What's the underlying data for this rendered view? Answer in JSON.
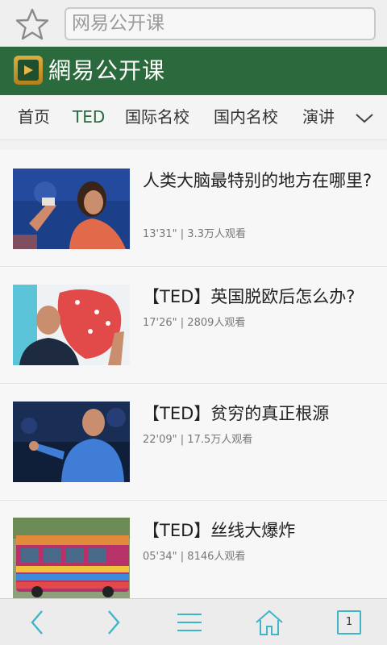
{
  "address_bar": {
    "text": "网易公开课"
  },
  "header": {
    "brand": "網易公开课"
  },
  "tabs": [
    {
      "label": "首页"
    },
    {
      "label": "TED"
    },
    {
      "label": "国际名校"
    },
    {
      "label": "国内名校"
    },
    {
      "label": "演讲"
    }
  ],
  "active_tab": "TED",
  "videos": [
    {
      "title": "人类大脑最特别的地方在哪里?",
      "duration": "13'31\"",
      "views": "3.3万人观看",
      "thumb_icon": "speaker-photo"
    },
    {
      "title": "【TED】英国脱欧后怎么办?",
      "duration": "17'26\"",
      "views": "2809人观看",
      "thumb_icon": "speaker-photo"
    },
    {
      "title": "【TED】贫穷的真正根源",
      "duration": "22'09\"",
      "views": "17.5万人观看",
      "thumb_icon": "speaker-photo"
    },
    {
      "title": "【TED】丝线大爆炸",
      "duration": "05'34\"",
      "views": "8146人观看",
      "thumb_icon": "bus-photo"
    }
  ],
  "bottom_bar": {
    "tab_count": "1"
  },
  "colors": {
    "brand_green": "#2a6a3c",
    "accent_cyan": "#3fb6c8"
  }
}
